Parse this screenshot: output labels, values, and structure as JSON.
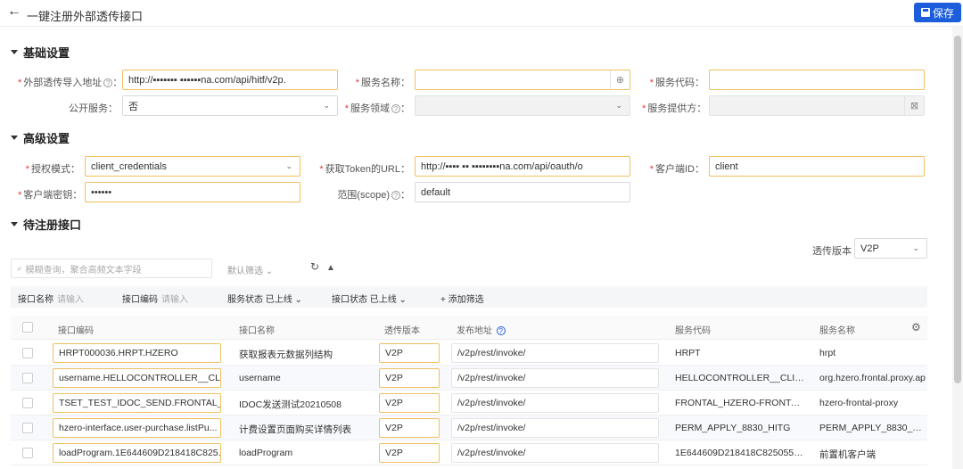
{
  "header": {
    "title": "一键注册外部透传接口",
    "save_label": "保存"
  },
  "sections": {
    "basic": "基础设置",
    "advanced": "高级设置",
    "pending": "待注册接口"
  },
  "basic": {
    "url_label": "外部透传导入地址",
    "url_value": "http://▪▪▪▪▪▪▪ ▪▪▪▪▪▪na.com/api/hitf/v2p.",
    "service_name_label": "服务名称：",
    "service_name_value": "",
    "service_code_label": "服务代码：",
    "service_code_value": "",
    "public_label": "公开服务：",
    "public_value": "否",
    "domain_label": "服务领域",
    "domain_value": "",
    "provider_label": "服务提供方：",
    "provider_value": ""
  },
  "advanced": {
    "auth_label": "授权模式：",
    "auth_value": "client_credentials",
    "token_label": "获取Token的URL：",
    "token_value": "http://▪▪▪▪ ▪▪ ▪▪▪▪▪▪▪▪na.com/api/oauth/o",
    "client_id_label": "客户端ID：",
    "client_id_value": "client",
    "secret_label": "客户端密钥：",
    "secret_value": "••••••",
    "scope_label": "范围(scope)",
    "scope_value": "default"
  },
  "pending": {
    "version_label": "透传版本",
    "version_value": "V2P",
    "search_placeholder": "模糊查询，聚合高频文本字段",
    "default_filter": "默认筛选",
    "filters": {
      "code_label": "接口名称",
      "code_ph": "请输入",
      "name_label": "接口编码",
      "name_ph": "请输入",
      "service_status": "服务状态 已上线",
      "iface_status": "接口状态 已上线",
      "add_filter": "添加筛选"
    },
    "columns": [
      "接口编码",
      "接口名称",
      "透传版本",
      "发布地址",
      "服务代码",
      "服务名称"
    ],
    "rows": [
      {
        "code": "HRPT000036.HRPT.HZERO",
        "name": "获取报表元数据列结构",
        "version": "V2P",
        "path": "/v2p/rest/invoke/",
        "svc_code": "HRPT",
        "svc_name": "hrpt"
      },
      {
        "code": "username.HELLOCONTROLLER__CLI...",
        "name": "username",
        "version": "V2P",
        "path": "/v2p/rest/invoke/",
        "svc_code": "HELLOCONTROLLER__CLIE...",
        "svc_name": "org.hzero.frontal.proxy.ap"
      },
      {
        "code": "TSET_TEST_IDOC_SEND.FRONTAL_H...",
        "name": "IDOC发送测试20210508",
        "version": "V2P",
        "path": "/v2p/rest/invoke/",
        "svc_code": "FRONTAL_HZERO-FRONTA...",
        "svc_name": "hzero-frontal-proxy"
      },
      {
        "code": "hzero-interface.user-purchase.listPu...",
        "name": "计费设置页面购买详情列表",
        "version": "V2P",
        "path": "/v2p/rest/invoke/",
        "svc_code": "PERM_APPLY_8830_HITG",
        "svc_name": "PERM_APPLY_8830_HITG"
      },
      {
        "code": "loadProgram.1E644609D218418C825...",
        "name": "loadProgram",
        "version": "V2P",
        "path": "/v2p/rest/invoke/",
        "svc_code": "1E644609D218418C8250559...",
        "svc_name": "前置机客户端"
      }
    ]
  }
}
